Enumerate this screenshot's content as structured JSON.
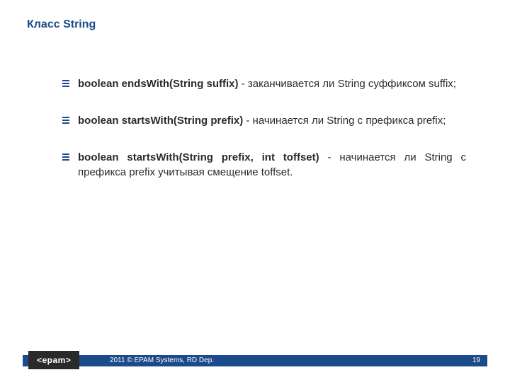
{
  "title": "Класс String",
  "bullets": [
    {
      "signature": "boolean endsWith(String suffix)",
      "description": " - заканчивается ли String суффиксом suffix;"
    },
    {
      "signature": "boolean startsWith(String prefix)",
      "description": " - начинается ли String с префикса prefix;"
    },
    {
      "signature": "boolean startsWith(String prefix, int toffset)",
      "description": " - начинается ли String с префикса prefix учитывая смещение toffset."
    }
  ],
  "footer": {
    "logo": "<epam>",
    "copyright": "2011 © EPAM Systems, RD Dep.",
    "page": "19"
  }
}
